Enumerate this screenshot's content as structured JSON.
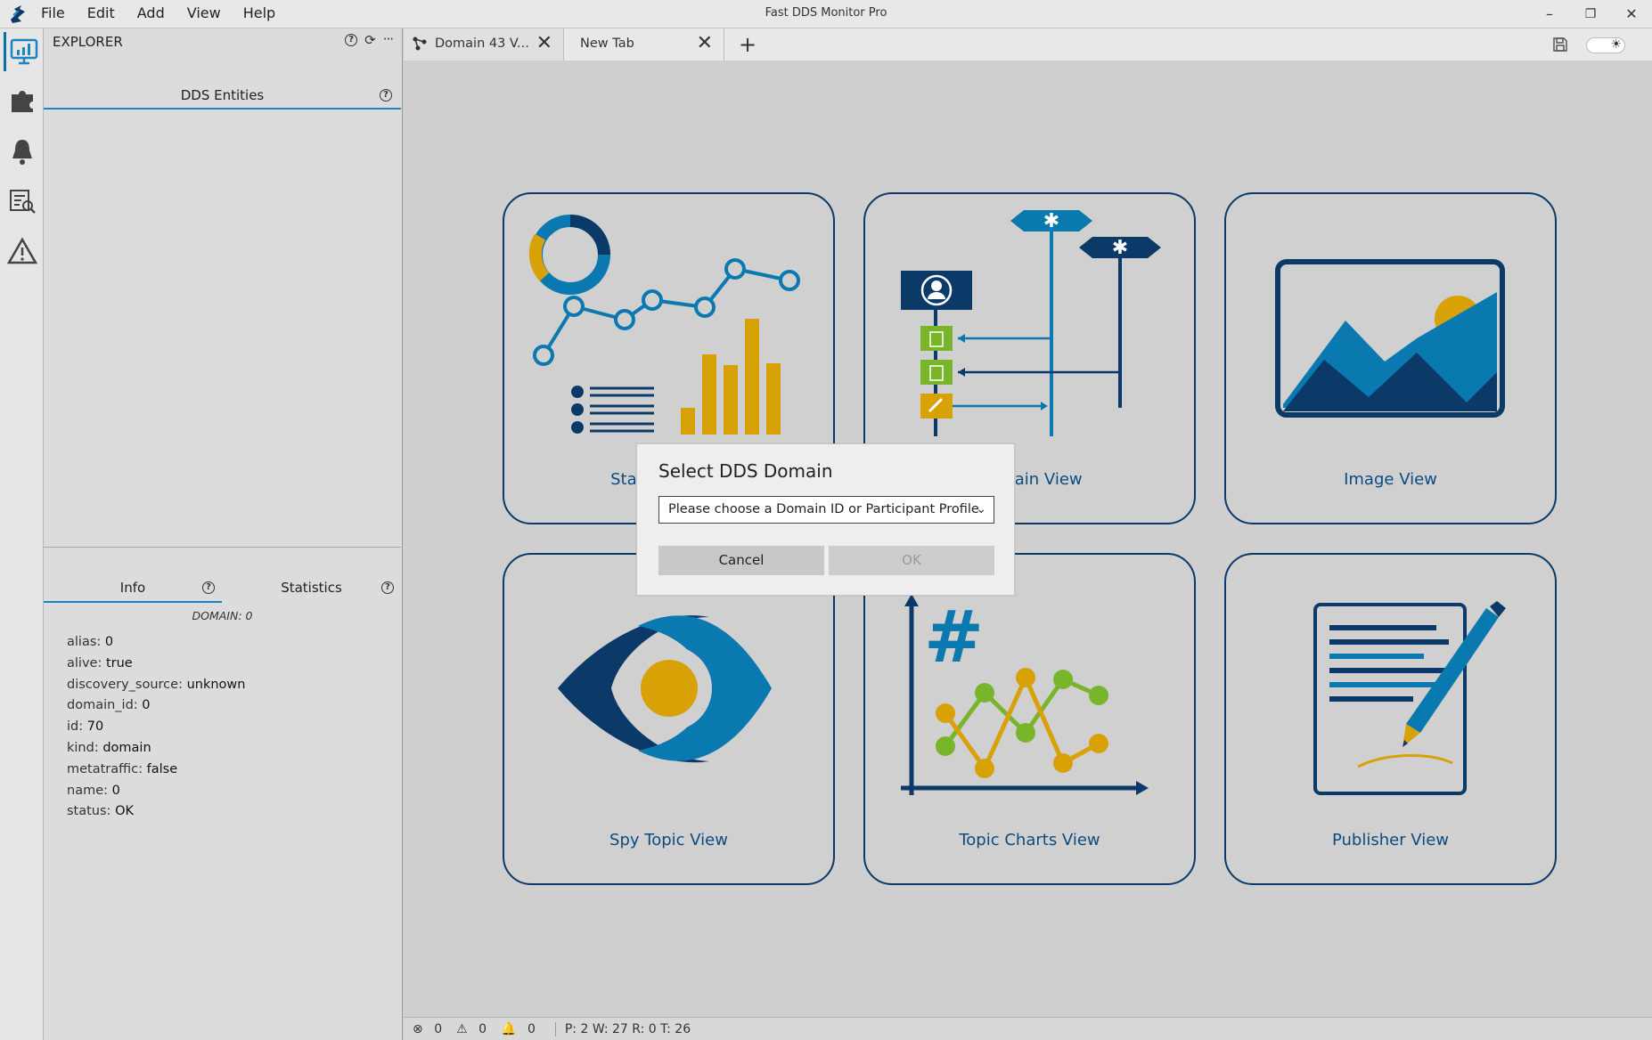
{
  "app": {
    "title": "Fast DDS Monitor Pro",
    "menu": [
      "File",
      "Edit",
      "Add",
      "View",
      "Help"
    ]
  },
  "activity_bar": [
    "explorer",
    "dds-entities",
    "alerts",
    "logs",
    "issues"
  ],
  "explorer": {
    "header": "EXPLORER",
    "entities_tab": "DDS Entities",
    "info_tab": "Info",
    "statistics_tab": "Statistics",
    "domain_title": "DOMAIN: 0",
    "properties": [
      {
        "key": "alias:",
        "value": "0"
      },
      {
        "key": "alive:",
        "value": "true"
      },
      {
        "key": "discovery_source:",
        "value": "unknown"
      },
      {
        "key": "domain_id:",
        "value": "0"
      },
      {
        "key": "id:",
        "value": "70"
      },
      {
        "key": "kind:",
        "value": "domain"
      },
      {
        "key": "metatraffic:",
        "value": "false"
      },
      {
        "key": "name:",
        "value": "0"
      },
      {
        "key": "status:",
        "value": "OK"
      }
    ]
  },
  "tabs": [
    {
      "label": "Domain 43 V..."
    },
    {
      "label": "New Tab"
    }
  ],
  "cards": [
    {
      "label": "Statistics View"
    },
    {
      "label": "Domain View"
    },
    {
      "label": "Image View"
    },
    {
      "label": "Spy Topic View"
    },
    {
      "label": "Topic Charts View"
    },
    {
      "label": "Publisher View"
    }
  ],
  "dialog": {
    "title": "Select DDS Domain",
    "combo_placeholder": "Please choose a Domain ID or Participant Profile",
    "cancel": "Cancel",
    "ok": "OK"
  },
  "statusbar": {
    "errors": "0",
    "warnings": "0",
    "notifications": "0",
    "counts": "P: 2  W: 27  R: 0  T: 26"
  },
  "colors": {
    "navy": "#0b3a68",
    "blue": "#0a79b0",
    "gold": "#d8a106",
    "green": "#78b52a",
    "accent": "#1d84c0"
  }
}
